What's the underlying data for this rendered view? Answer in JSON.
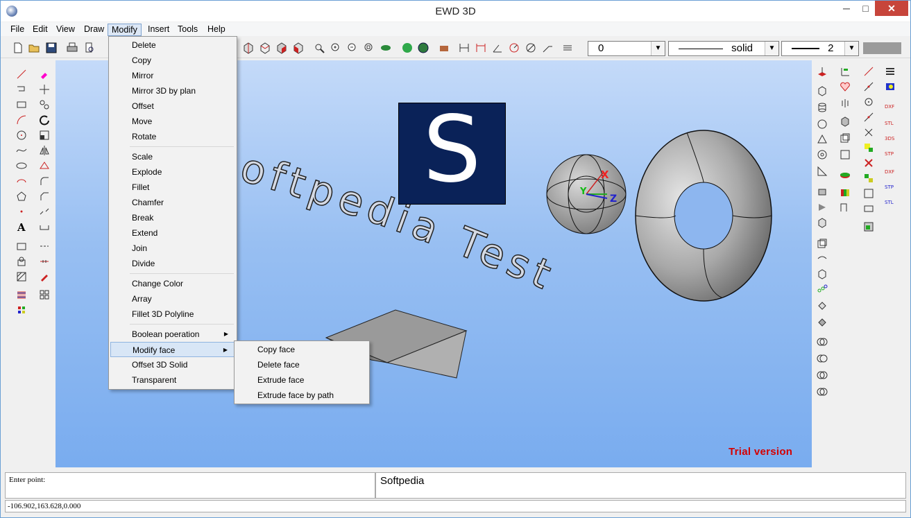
{
  "window": {
    "title": "EWD 3D",
    "min": "─",
    "max": "□",
    "close": "✕"
  },
  "menubar": [
    "File",
    "Edit",
    "View",
    "Draw",
    "Modify",
    "Insert",
    "Tools",
    "Help"
  ],
  "toolbar": {
    "layer_value": "0",
    "linetype_value": "solid",
    "lineweight_value": "2"
  },
  "modify_menu": {
    "items": [
      "Delete",
      "Copy",
      "Mirror",
      "Mirror 3D by plan",
      "Offset",
      "Move",
      "Rotate",
      "Scale",
      "Explode",
      "Fillet",
      "Chamfer",
      "Break",
      "Extend",
      "Join",
      "Divide",
      "Change Color",
      "Array",
      "Fillet 3D Polyline",
      "Boolean poeration",
      "Modify face",
      "Offset 3D Solid",
      "Transparent"
    ]
  },
  "submenu": {
    "items": [
      "Copy face",
      "Delete face",
      "Extrude face",
      "Extrude face by path"
    ]
  },
  "viewport": {
    "curved_text": "Softpedia Test",
    "logo_letter": "S",
    "trial": "Trial version",
    "axis_x": "X",
    "axis_y": "Y",
    "axis_z": "Z"
  },
  "status": {
    "prompt": "Enter point:",
    "command_value": "Softpedia",
    "coords": "-106.902,163.628,0.000"
  },
  "icon_names": [
    "new-file-icon",
    "open-folder-icon",
    "save-icon",
    "print-icon",
    "print-preview-icon"
  ],
  "right_text_icons": [
    "DXF",
    "STL",
    "3DS",
    "STP",
    "DXF",
    "STP",
    "STL"
  ]
}
